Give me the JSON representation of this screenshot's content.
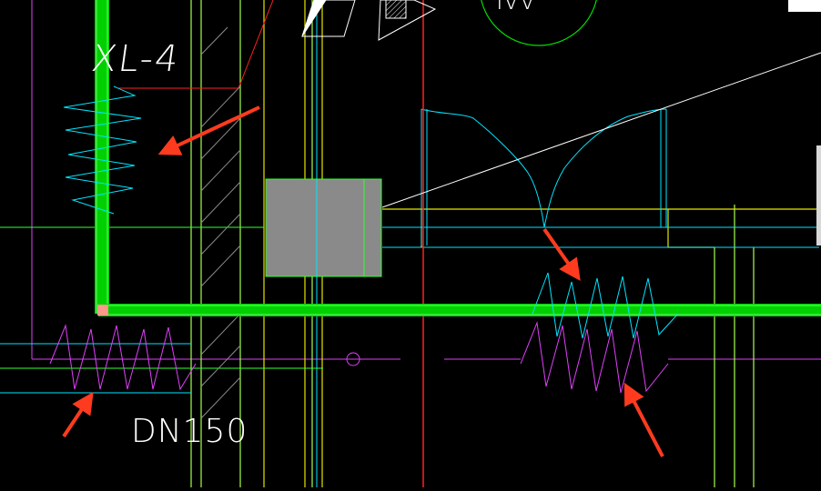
{
  "drawing": {
    "labels": {
      "riser_id": "XL-4",
      "pipe_size": "DN150"
    },
    "colors": {
      "background": "#000000",
      "thick_pipe": "#00e000",
      "thin_green": "#00ff00",
      "cyan": "#00e5ff",
      "magenta": "#e040fb",
      "yellow": "#e6e600",
      "red_line": "#ff0000",
      "white": "#ffffff",
      "gray_fill": "#8a8a8a",
      "annotation_arrow": "#ff3b1f",
      "light_green": "#a6ff4d",
      "hatch": "#9a9a9a"
    },
    "icons": [
      "break-symbol-cyan",
      "break-symbol-magenta",
      "annotation-arrow",
      "equipment-block"
    ]
  }
}
